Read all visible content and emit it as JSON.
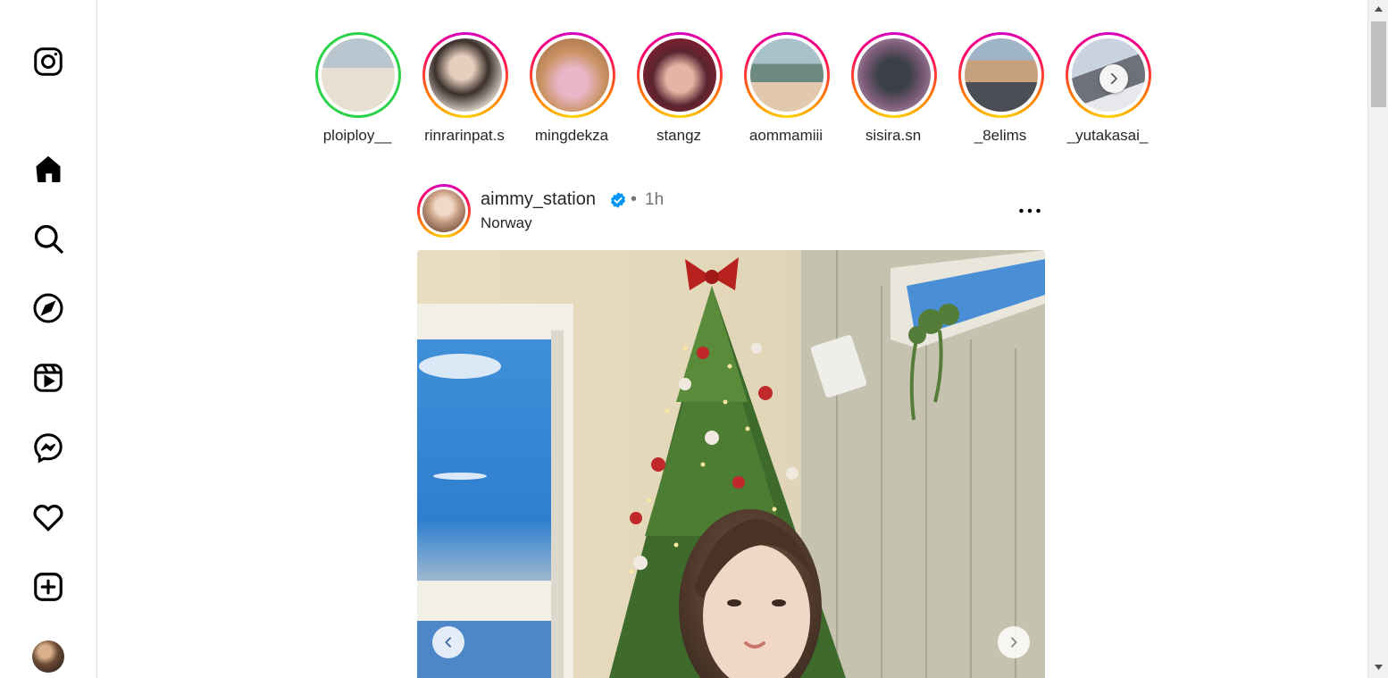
{
  "sidebar": {
    "items": [
      {
        "icon": "instagram-logo-icon"
      },
      {
        "icon": "home-icon"
      },
      {
        "icon": "search-icon"
      },
      {
        "icon": "explore-compass-icon"
      },
      {
        "icon": "reels-icon"
      },
      {
        "icon": "messenger-icon"
      },
      {
        "icon": "heart-icon"
      },
      {
        "icon": "create-plus-icon"
      },
      {
        "icon": "profile-avatar"
      }
    ]
  },
  "stories": [
    {
      "username": "ploiploy__",
      "seen": true
    },
    {
      "username": "rinrarinpat.s",
      "seen": false
    },
    {
      "username": "mingdekza",
      "seen": false
    },
    {
      "username": "stangz",
      "seen": false
    },
    {
      "username": "aommamiii",
      "seen": false
    },
    {
      "username": "sisira.sn",
      "seen": false
    },
    {
      "username": "_8elims",
      "seen": false
    },
    {
      "username": "_yutakasai_",
      "seen": false
    }
  ],
  "post": {
    "username": "aimmy_station",
    "verified": true,
    "separator": "•",
    "time": "1h",
    "location": "Norway"
  },
  "colors": {
    "verified_blue": "#0095f6",
    "border": "#dbdbdb",
    "muted_text": "#737373"
  }
}
